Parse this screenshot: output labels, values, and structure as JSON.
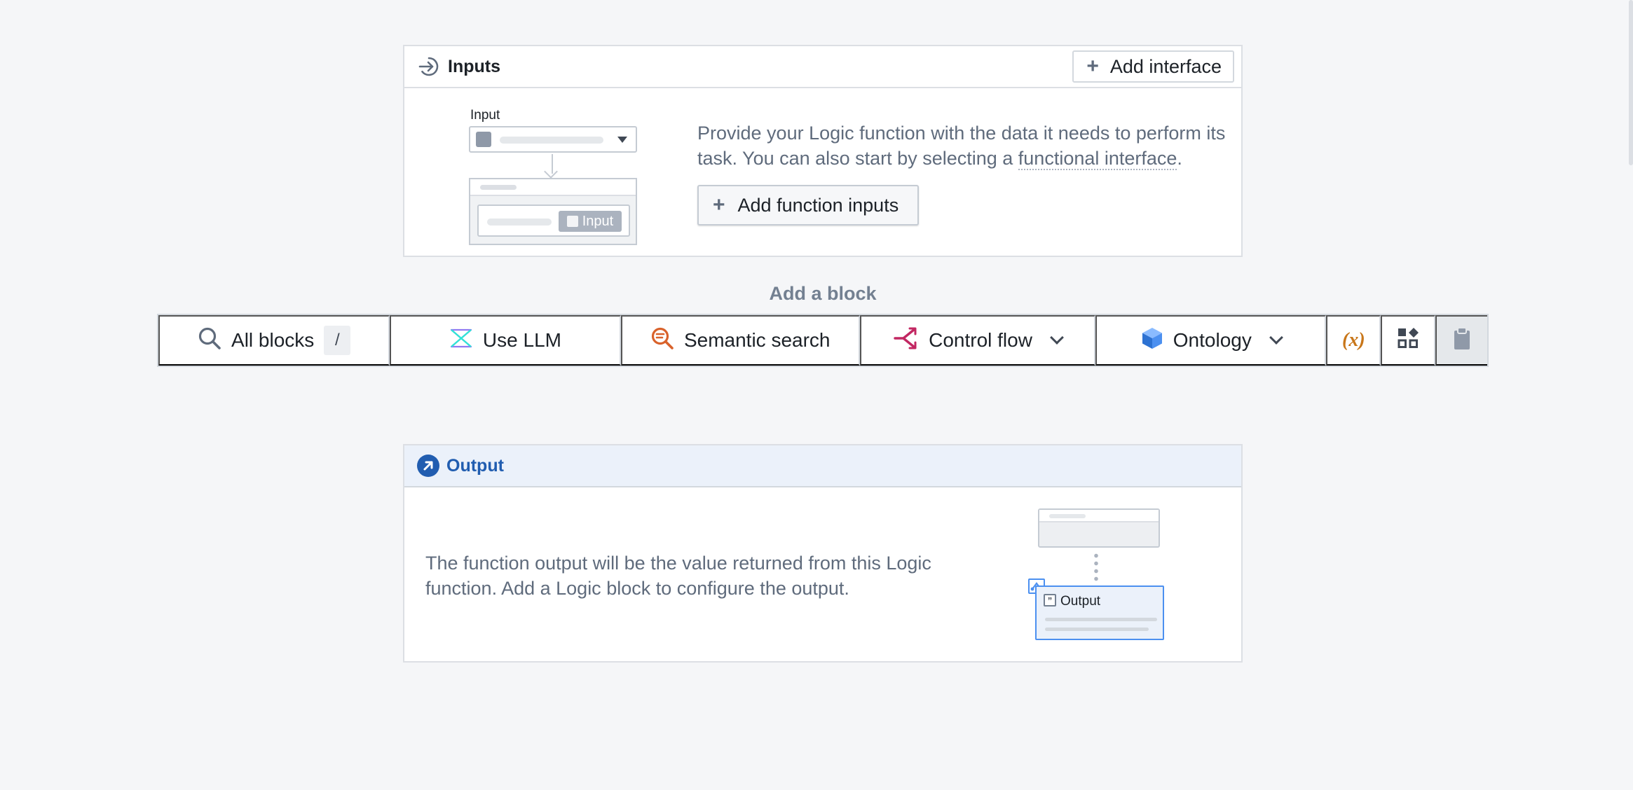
{
  "inputs": {
    "title": "Inputs",
    "add_interface_label": "Add interface",
    "illustration": {
      "label": "Input",
      "chip_label": "Input"
    },
    "description_part1": "Provide your Logic function with the data it needs to perform its task. You can also start by selecting a ",
    "description_link": "functional interface",
    "description_part2": ".",
    "add_function_inputs_label": "Add function inputs"
  },
  "add_block": {
    "title": "Add a block",
    "buttons": [
      {
        "label": "All blocks",
        "shortcut": "/",
        "icon": "search-icon"
      },
      {
        "label": "Use LLM",
        "icon": "llm-icon"
      },
      {
        "label": "Semantic search",
        "icon": "semantic-search-icon"
      },
      {
        "label": "Control flow",
        "icon": "control-flow-icon"
      },
      {
        "label": "Ontology",
        "icon": "cube-icon"
      },
      {
        "label": "(x)",
        "icon": "variable-icon"
      },
      {
        "label": "",
        "icon": "apps-icon"
      },
      {
        "label": "",
        "icon": "clipboard-icon"
      }
    ]
  },
  "output": {
    "title": "Output",
    "description": "The function output will be the value returned from this Logic function. Add a Logic block to configure the output.",
    "illustration_label": "Output"
  },
  "colors": {
    "background": "#f5f6f8",
    "accent_blue": "#215db0",
    "llm_teal": "#32a467",
    "semantic_orange": "#d9622b",
    "control_flow_pink": "#c22762",
    "ontology_blue": "#4c90f0",
    "variable_orange": "#c87619"
  }
}
